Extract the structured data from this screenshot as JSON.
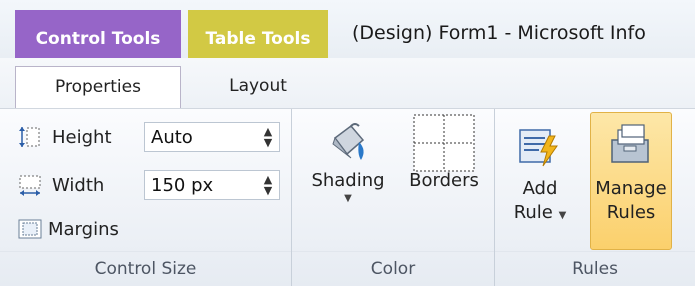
{
  "contextual_tabs": {
    "control_tools": "Control Tools",
    "table_tools": "Table Tools"
  },
  "window": {
    "title": "(Design) Form1  -  Microsoft Info"
  },
  "tabs": {
    "properties": "Properties",
    "layout": "Layout"
  },
  "groups": {
    "control_size": {
      "label": "Control Size",
      "height_label": "Height",
      "height_value": "Auto",
      "width_label": "Width",
      "width_value": "150 px",
      "margins_label": "Margins"
    },
    "color": {
      "label": "Color",
      "shading_label": "Shading",
      "borders_label": "Borders"
    },
    "rules": {
      "label": "Rules",
      "add_rule_line1": "Add",
      "add_rule_line2": "Rule",
      "manage_rules_line1": "Manage",
      "manage_rules_line2": "Rules"
    }
  },
  "icons": {
    "height": "height-icon",
    "width": "width-icon",
    "margins": "margins-icon",
    "shading": "paint-bucket-icon",
    "borders": "borders-icon",
    "add_rule": "add-rule-icon",
    "manage_rules": "manage-rules-icon"
  },
  "colors": {
    "control_tools": "#9665c8",
    "table_tools": "#d2c944",
    "hover_highlight": "#fbd06c"
  }
}
